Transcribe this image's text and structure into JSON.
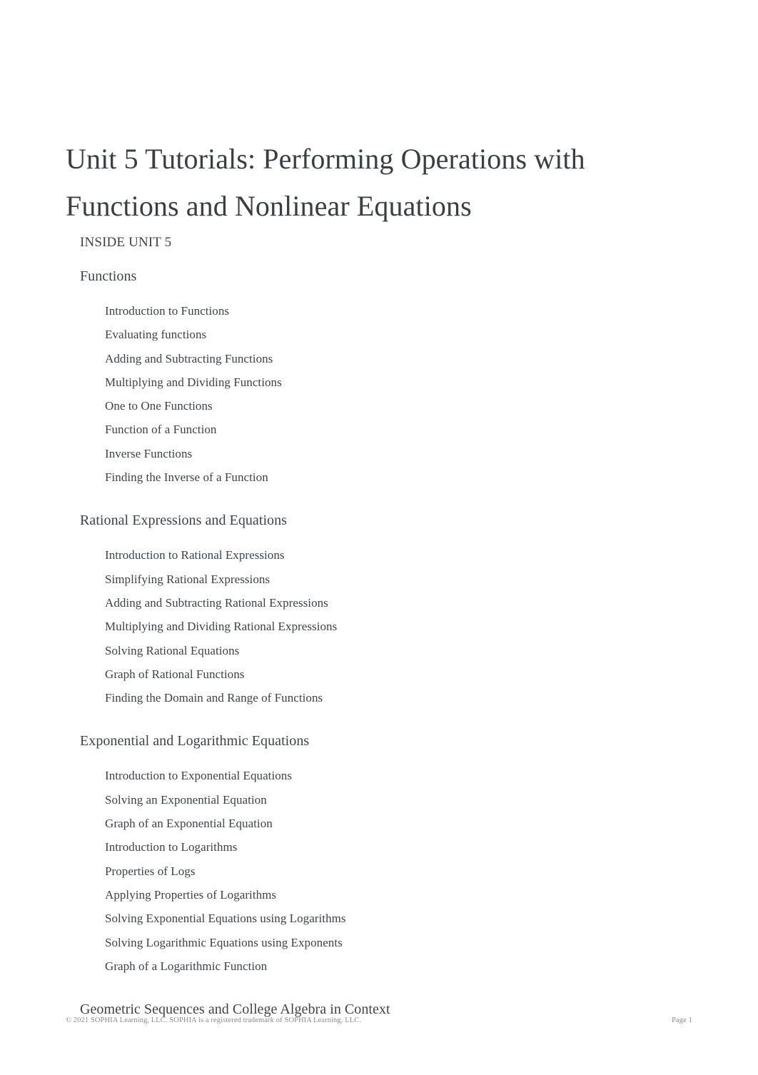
{
  "document": {
    "title": "Unit 5 Tutorials: Performing Operations with Functions and Nonlinear Equations",
    "inside_label": "INSIDE UNIT 5",
    "text_color": "#3f4247",
    "title_color": "#3a3d42",
    "footer_color": "#8b8b8b",
    "background_color": "#ffffff"
  },
  "sections": [
    {
      "heading": "Functions",
      "items": [
        "Introduction to Functions",
        "Evaluating functions",
        "Adding and Subtracting Functions",
        "Multiplying and Dividing Functions",
        "One to One Functions",
        "Function of a Function",
        "Inverse Functions",
        "Finding the Inverse of a Function"
      ]
    },
    {
      "heading": "Rational Expressions and Equations",
      "items": [
        "Introduction to Rational Expressions",
        "Simplifying Rational Expressions",
        "Adding and Subtracting Rational Expressions",
        "Multiplying and Dividing Rational Expressions",
        "Solving Rational Equations",
        "Graph of Rational Functions",
        "Finding the Domain and Range of Functions"
      ]
    },
    {
      "heading": "Exponential and Logarithmic Equations",
      "items": [
        "Introduction to Exponential Equations",
        "Solving an Exponential Equation",
        "Graph of an Exponential Equation",
        "Introduction to Logarithms",
        "Properties of Logs",
        "Applying Properties of Logarithms",
        "Solving Exponential Equations using Logarithms",
        "Solving Logarithmic Equations using Exponents",
        "Graph of a Logarithmic Function"
      ]
    },
    {
      "heading": "Geometric Sequences and College Algebra in Context",
      "items": []
    }
  ],
  "footer": {
    "copyright": "© 2021 SOPHIA Learning, LLC. SOPHIA is a registered trademark of SOPHIA Learning, LLC.",
    "page": "Page 1"
  }
}
